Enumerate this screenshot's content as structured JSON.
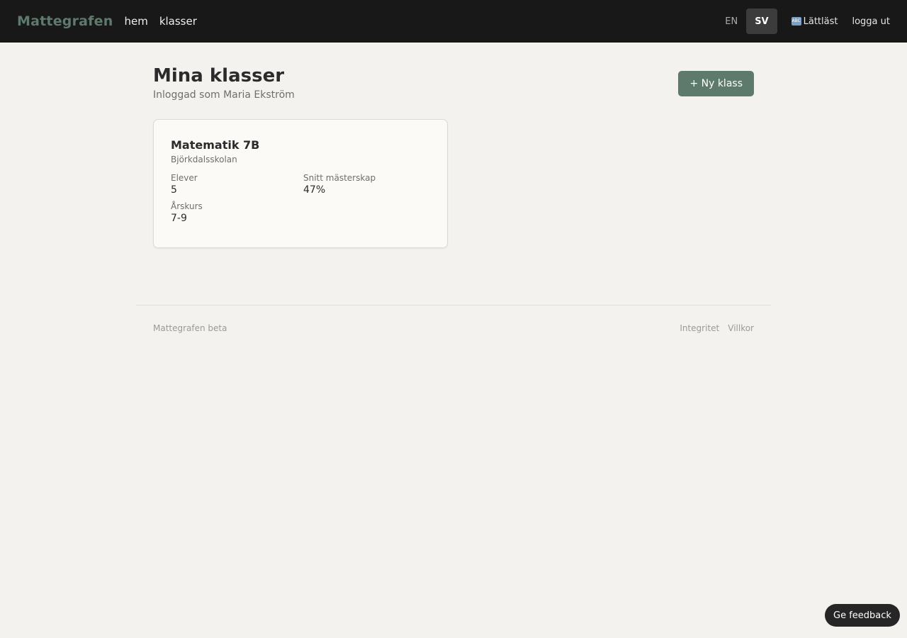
{
  "nav": {
    "brand": "Mattegrafen",
    "links": [
      "hem",
      "klasser"
    ],
    "languages": [
      "EN",
      "SV"
    ],
    "active_language": "SV",
    "easy_read": "Lättläst",
    "logout": "logga ut"
  },
  "header": {
    "title": "Mina klasser",
    "subtitle": "Inloggad som Maria Ekström",
    "new_class_button": "+ Ny klass"
  },
  "classes": [
    {
      "name": "Matematik 7B",
      "school": "Björkdalsskolan",
      "stats": [
        {
          "label": "Elever",
          "value": "5"
        },
        {
          "label": "Snitt mästerskap",
          "value": "47%"
        },
        {
          "label": "Årskurs",
          "value": "7-9"
        }
      ]
    }
  ],
  "footer": {
    "left": "Mattegrafen beta",
    "links": [
      "Integritet",
      "Villkor"
    ]
  },
  "feedback_button": "Ge feedback",
  "colors": {
    "accent": "#5e7a6c",
    "topbar": "#181818",
    "background": "#f3f2ee"
  }
}
